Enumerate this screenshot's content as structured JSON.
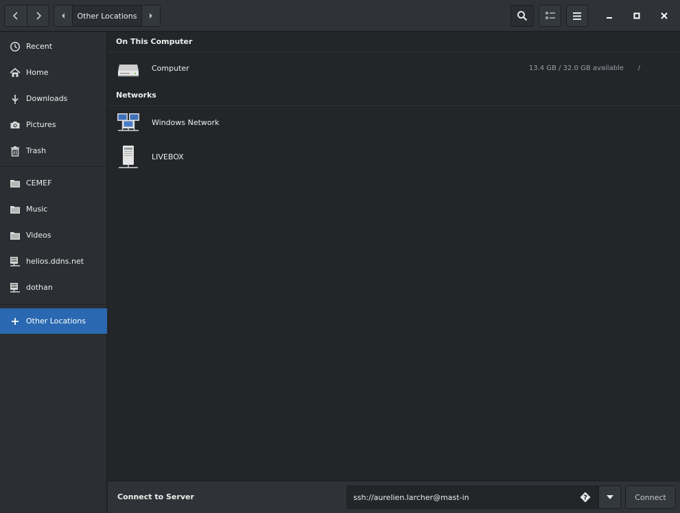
{
  "header": {
    "back_icon": "chevron-left-icon",
    "forward_icon": "chevron-right-icon",
    "path_current": "Other Locations",
    "search_icon": "search-icon",
    "view_icon": "list-view-icon",
    "menu_icon": "hamburger-menu-icon",
    "minimize_icon": "minimize-icon",
    "maximize_icon": "maximize-icon",
    "close_icon": "close-icon"
  },
  "sidebar": {
    "items": [
      {
        "label": "Recent",
        "icon": "clock-icon"
      },
      {
        "label": "Home",
        "icon": "home-icon"
      },
      {
        "label": "Downloads",
        "icon": "download-icon"
      },
      {
        "label": "Pictures",
        "icon": "camera-icon"
      },
      {
        "label": "Trash",
        "icon": "trash-icon"
      }
    ],
    "bookmarks": [
      {
        "label": "CEMEF",
        "icon": "folder-icon"
      },
      {
        "label": "Music",
        "icon": "folder-icon"
      },
      {
        "label": "Videos",
        "icon": "folder-icon"
      },
      {
        "label": "helios.ddns.net",
        "icon": "network-server-icon"
      },
      {
        "label": "dothan",
        "icon": "network-server-icon"
      }
    ],
    "other": {
      "label": "Other Locations",
      "icon": "plus-icon"
    }
  },
  "main": {
    "on_this_computer": {
      "title": "On This Computer",
      "items": [
        {
          "label": "Computer",
          "info": "13.4 GB / 32.0 GB available",
          "mount": "/",
          "icon": "hard-drive-icon"
        }
      ]
    },
    "networks": {
      "title": "Networks",
      "items": [
        {
          "label": "Windows Network",
          "icon": "network-workgroup-icon"
        },
        {
          "label": "LIVEBOX",
          "icon": "server-icon"
        }
      ]
    }
  },
  "connect": {
    "label": "Connect to Server",
    "value": "ssh://aurelien.larcher@mast-in",
    "help_icon": "question-icon",
    "dropdown_icon": "caret-down-icon",
    "button": "Connect"
  },
  "colors": {
    "accent": "#2a69b1",
    "background": "#232629",
    "sidebar": "#2b2f33",
    "headerbar": "#2f3338"
  }
}
